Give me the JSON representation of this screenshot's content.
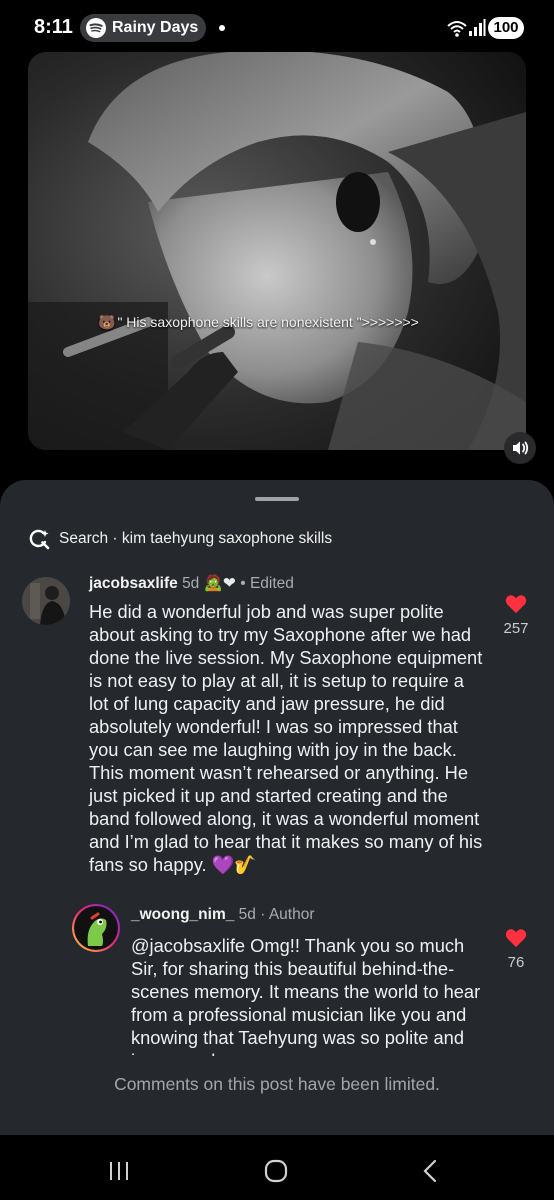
{
  "status_bar": {
    "time": "8:11",
    "media_title": "Rainy Days",
    "battery": "100",
    "icons": [
      "spotify-icon",
      "wifi-icon",
      "signal-icon"
    ]
  },
  "video": {
    "caption_emoji": "🐻",
    "caption": "\" His saxophone skills are nonexistent \">>>>>>>",
    "sound_icon": "volume-icon"
  },
  "search": {
    "label": "Search · kim taehyung saxophone skills"
  },
  "comments": [
    {
      "username": "jacobsaxlife",
      "age": "5d",
      "badge": "🧟❤",
      "tag": "• Edited",
      "text": "He did a wonderful job and was super polite about asking to try my Saxophone after we had done the live session. My Saxophone equipment is not easy to play at all, it is setup to require a lot of lung capacity and jaw pressure, he did absolutely wonderful! I was so impressed that you can see me laughing with joy in the back. This moment wasn’t rehearsed or anything. He just picked it up and started creating and the band followed along, it was a wonderful moment and I’m glad to hear that it makes so many of his fans so happy. 💜🎷",
      "likes": "257",
      "liked": true
    },
    {
      "username": "_woong_nim_",
      "age": "5d",
      "tag": "· Author",
      "text": "@jacobsaxlife Omg!! Thank you so much Sir, for sharing this beautiful behind-the-scenes memory. It means the world to hear from a professional musician like you and knowing that Taehyung was so polite and impressed",
      "likes": "76",
      "liked": true
    }
  ],
  "footer": {
    "limited_text": "Comments on this post have been limited."
  },
  "colors": {
    "sheet": "#25282c",
    "heart": "#ff3040",
    "background": "#000000"
  }
}
